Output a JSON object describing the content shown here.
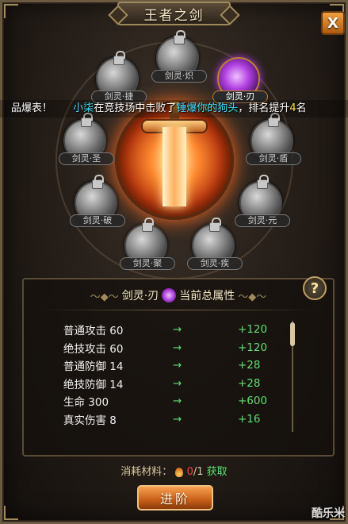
{
  "window": {
    "title": "王者之剑",
    "close_label": "X"
  },
  "ticker": {
    "prefix": "品爆表！",
    "player": "小柒",
    "action": "在竞技场中击败了",
    "opponent": "锤爆你的狗头",
    "result_prefix": "，排名提升",
    "rank_change": "4",
    "result_suffix": "名"
  },
  "nodes": [
    {
      "label": "剑灵·炽",
      "locked": true
    },
    {
      "label": "剑灵·刃",
      "locked": false,
      "active": true
    },
    {
      "label": "剑灵·盾",
      "locked": true
    },
    {
      "label": "剑灵·元",
      "locked": true
    },
    {
      "label": "剑灵·疾",
      "locked": true
    },
    {
      "label": "剑灵·聚",
      "locked": true
    },
    {
      "label": "剑灵·破",
      "locked": true
    },
    {
      "label": "剑灵·圣",
      "locked": true
    },
    {
      "label": "剑灵·捷",
      "locked": true
    }
  ],
  "attributes_panel": {
    "name": "剑灵·刃",
    "title_suffix": "当前总属性",
    "help_label": "?",
    "rows": [
      {
        "name": "普通攻击 60",
        "arrow": "→",
        "gain": "+120"
      },
      {
        "name": "绝技攻击 60",
        "arrow": "→",
        "gain": "+120"
      },
      {
        "name": "普通防御 14",
        "arrow": "→",
        "gain": "+28"
      },
      {
        "name": "绝技防御 14",
        "arrow": "→",
        "gain": "+28"
      },
      {
        "name": "生命 300",
        "arrow": "→",
        "gain": "+600"
      },
      {
        "name": "真实伤害 8",
        "arrow": "→",
        "gain": "+16"
      }
    ]
  },
  "material": {
    "label": "消耗材料：",
    "current": "0",
    "required": "/1",
    "get_label": "获取",
    "icon": "flame-icon"
  },
  "advance_button": "进阶",
  "watermark": "酷乐米",
  "colors": {
    "accent": "#c8601a",
    "gain_green": "#60e070",
    "ticker_cyan": "#40e0ff",
    "ticker_yellow": "#ffe040",
    "insufficient_red": "#ff4040"
  }
}
